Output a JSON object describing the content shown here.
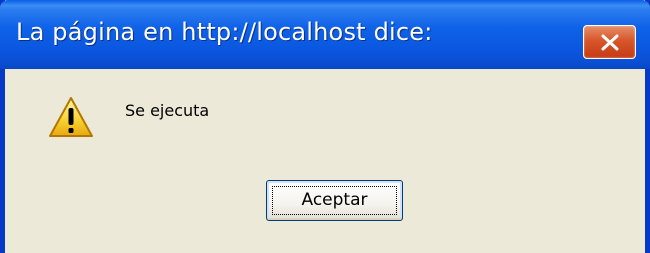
{
  "dialog": {
    "title": "La página en http://localhost dice:",
    "message": "Se ejecuta",
    "ok_label": "Aceptar",
    "icon": "warning-icon",
    "close_icon": "close-icon"
  },
  "colors": {
    "titlebar": "#0a5ce6",
    "border": "#0838c8",
    "background": "#ece9d8",
    "close_button": "#d8572a",
    "warning_yellow": "#f8d030"
  }
}
